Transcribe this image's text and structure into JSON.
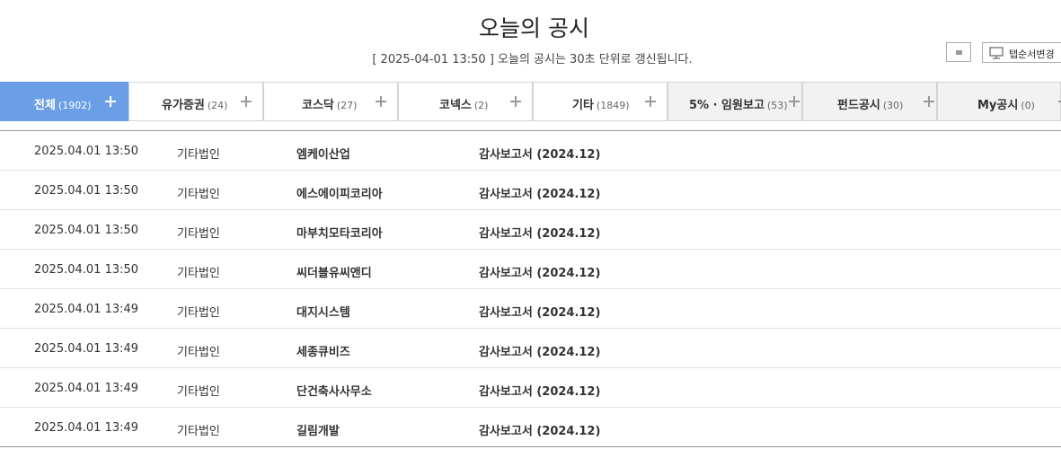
{
  "header": {
    "title": "오늘의 공시",
    "subtitle": "[ 2025-04-01 13:50 ] 오늘의 공시는 30초 단위로 갱신됩니다.",
    "tab_order_label": "탭순서변경"
  },
  "tabs": [
    {
      "label": "전체",
      "count": "(1902)"
    },
    {
      "label": "유가증권",
      "count": "(24)"
    },
    {
      "label": "코스닥",
      "count": "(27)"
    },
    {
      "label": "코넥스",
      "count": "(2)"
    },
    {
      "label": "기타",
      "count": "(1849)"
    },
    {
      "label": "5% · 임원보고",
      "count": "(53)"
    },
    {
      "label": "펀드공시",
      "count": "(30)"
    },
    {
      "label": "My공시",
      "count": "(0)"
    }
  ],
  "rows": [
    {
      "time": "2025.04.01  13:50",
      "market": "기타법인",
      "company": "엠케이산업",
      "report": "감사보고서 (2024.12)"
    },
    {
      "time": "2025.04.01  13:50",
      "market": "기타법인",
      "company": "에스에이피코리아",
      "report": "감사보고서 (2024.12)"
    },
    {
      "time": "2025.04.01  13:50",
      "market": "기타법인",
      "company": "마부치모타코리아",
      "report": "감사보고서 (2024.12)"
    },
    {
      "time": "2025.04.01  13:50",
      "market": "기타법인",
      "company": "씨더블유씨앤디",
      "report": "감사보고서 (2024.12)"
    },
    {
      "time": "2025.04.01  13:49",
      "market": "기타법인",
      "company": "대지시스템",
      "report": "감사보고서 (2024.12)"
    },
    {
      "time": "2025.04.01  13:49",
      "market": "기타법인",
      "company": "세종큐비즈",
      "report": "감사보고서 (2024.12)"
    },
    {
      "time": "2025.04.01  13:49",
      "market": "기타법인",
      "company": "단건축사사무소",
      "report": "감사보고서 (2024.12)"
    },
    {
      "time": "2025.04.01  13:49",
      "market": "기타법인",
      "company": "길림개발",
      "report": "감사보고서 (2024.12)"
    }
  ],
  "colors": {
    "active_tab": "#6a9fe8",
    "inactive_tab_alt": "#f2f2f2"
  },
  "icons": [
    "stop-icon",
    "monitor-icon",
    "plus-icon"
  ]
}
